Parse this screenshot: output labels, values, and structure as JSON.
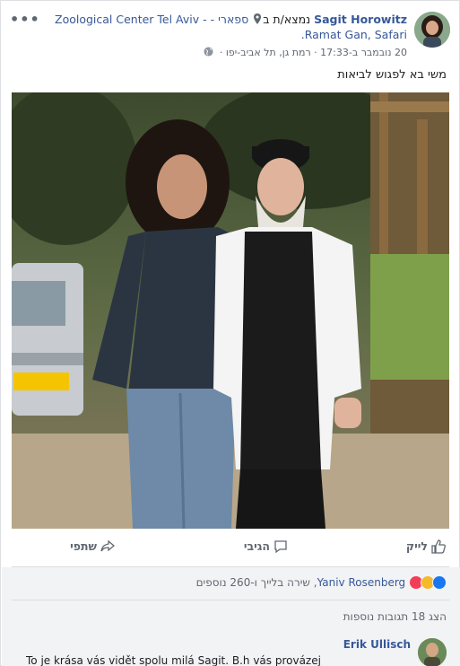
{
  "post": {
    "author": "Sagit Horowitz",
    "at_text": "נמצא/ת ב",
    "location": "ספארי - - Zoological Center Tel Aviv Ramat Gan, Safari.",
    "timestamp": "20 נובמבר ב-17:33",
    "place": "רמת גן, תל אביב-יפו",
    "separator": "·",
    "text": "משי בא לפגוש לביאות",
    "more_icon": "more-options-icon"
  },
  "actions": {
    "like": "לייק",
    "comment": "הגיבי",
    "share": "שתפי"
  },
  "reactions": {
    "friend": "Yaniv Rosenberg",
    "rest": ", שירה בלייך ו-260 נוספים",
    "icons": [
      "like",
      "haha",
      "love"
    ],
    "colors": {
      "like": "#1877f2",
      "haha": "#f7b928",
      "love": "#f33e58"
    }
  },
  "comments": {
    "more_label": "הצג 18 תגובות נוספות",
    "items": [
      {
        "name": "Erik Ullisch",
        "text": "To je krása vás vidět spolu milá Sagit. B.h vás provázej"
      }
    ]
  },
  "colors": {
    "link": "#365899",
    "muted": "#606770",
    "bg_gray": "#f2f3f5"
  }
}
